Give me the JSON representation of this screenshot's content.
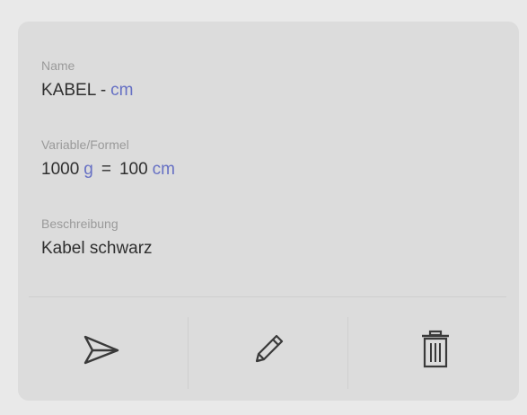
{
  "card": {
    "name": {
      "label": "Name",
      "text": "KABEL -",
      "unit": "cm"
    },
    "formula": {
      "label": "Variable/Formel",
      "left_value": "1000",
      "left_unit": "g",
      "operator": "=",
      "right_value": "100",
      "right_unit": "cm"
    },
    "description": {
      "label": "Beschreibung",
      "text": "Kabel schwarz"
    }
  },
  "actions": [
    {
      "icon": "send-icon"
    },
    {
      "icon": "pencil-icon"
    },
    {
      "icon": "trash-icon"
    }
  ],
  "colors": {
    "background": "#e9e9e9",
    "card": "#dcdcdc",
    "label": "#9a9a9a",
    "text": "#2f2f2f",
    "unit_accent": "#6670c4",
    "icon": "#3a3a3a"
  }
}
